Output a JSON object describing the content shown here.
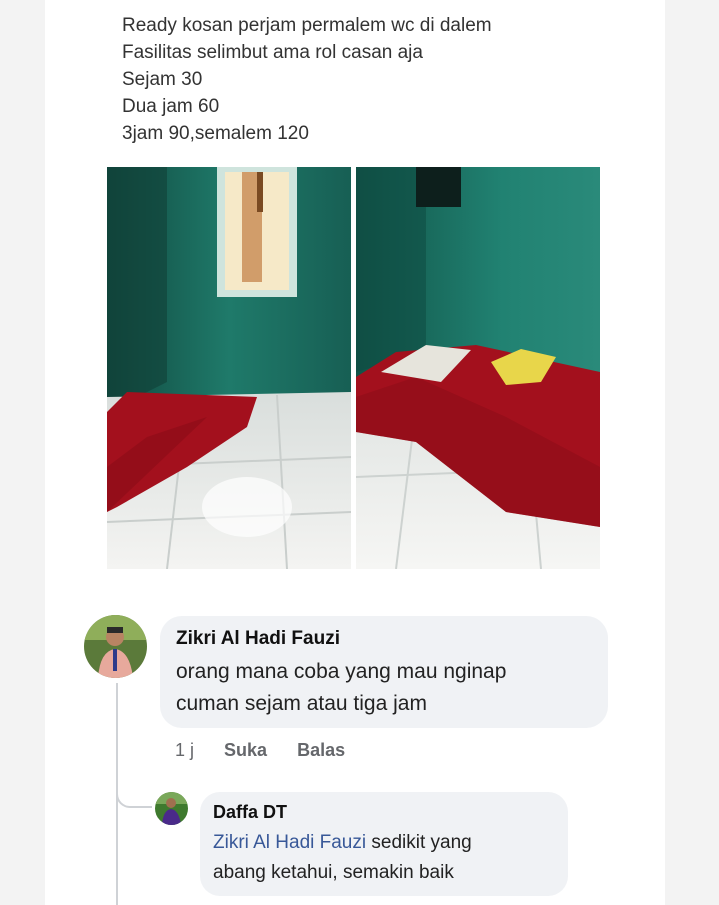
{
  "post": {
    "lines": [
      "Ready kosan perjam permalem wc di dalem",
      "Fasilitas selimbut ama rol casan aja",
      "Sejam 30",
      "Dua jam 60",
      "3jam 90,semalem 120"
    ]
  },
  "comment": {
    "author": "Zikri Al Hadi Fauzi",
    "line1": "orang mana coba yang mau nginap",
    "line2": "cuman sejam atau tiga jam",
    "time": "1 j",
    "like_label": "Suka",
    "reply_label": "Balas"
  },
  "reply": {
    "author": "Daffa DT",
    "mention": "Zikri Al Hadi Fauzi",
    "line1_rest": " sedikit yang",
    "line2": "abang ketahui, semakin baik"
  },
  "colors": {
    "mention": "#385898",
    "bubble": "#f0f2f5",
    "wall": "#1f7a6a",
    "mattress": "#a3101d"
  }
}
